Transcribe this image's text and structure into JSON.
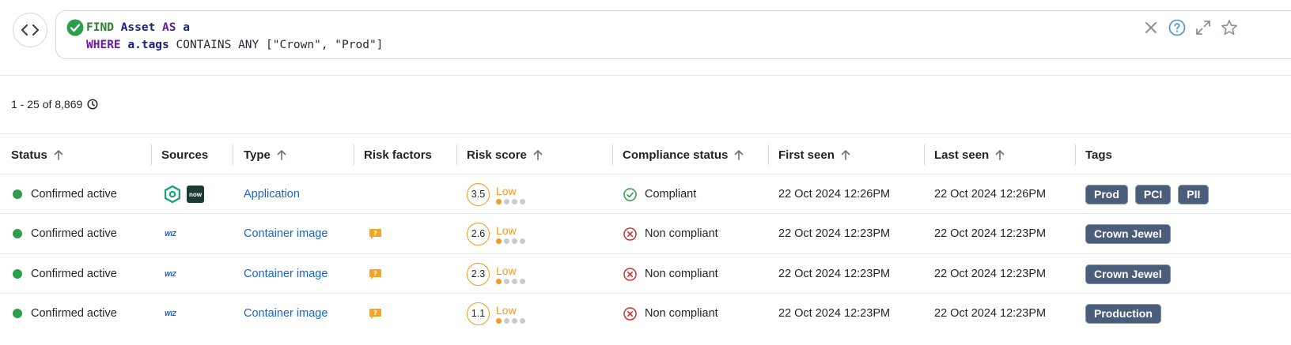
{
  "query": {
    "line1": [
      {
        "text": "FIND",
        "style": "kw-green"
      },
      {
        "text": " ",
        "style": "q-plain"
      },
      {
        "text": "Asset",
        "style": "kw-navy"
      },
      {
        "text": " ",
        "style": "q-plain"
      },
      {
        "text": "AS",
        "style": "kw-purple"
      },
      {
        "text": " ",
        "style": "q-plain"
      },
      {
        "text": "a",
        "style": "kw-navy"
      }
    ],
    "line2": [
      {
        "text": "WHERE",
        "style": "kw-purple"
      },
      {
        "text": " ",
        "style": "q-plain"
      },
      {
        "text": "a.tags",
        "style": "kw-navy"
      },
      {
        "text": " CONTAINS ANY [\"Crown\", \"Prod\"]",
        "style": "q-plain"
      }
    ],
    "icons": [
      "close-icon",
      "help-icon",
      "expand-icon",
      "star-icon"
    ]
  },
  "results": {
    "count_text": "1 - 25 of 8,869"
  },
  "table": {
    "columns": [
      {
        "label": "Status",
        "sortable": true
      },
      {
        "label": "Sources",
        "sortable": false
      },
      {
        "label": "Type",
        "sortable": true
      },
      {
        "label": "Risk factors",
        "sortable": false
      },
      {
        "label": "Risk score",
        "sortable": true
      },
      {
        "label": "Compliance status",
        "sortable": true
      },
      {
        "label": "First seen",
        "sortable": true
      },
      {
        "label": "Last seen",
        "sortable": true
      },
      {
        "label": "Tags",
        "sortable": false
      }
    ],
    "rows": [
      {
        "status": "Confirmed active",
        "sources": [
          "hexagon-source-icon",
          "now-source-icon"
        ],
        "now_label": "now",
        "type": "Application",
        "risk_factor": false,
        "score": "3.5",
        "score_label": "Low",
        "score_level": 1,
        "compliance": "Compliant",
        "compliant": true,
        "first_seen": "22 Oct 2024 12:26PM",
        "last_seen": "22 Oct 2024 12:26PM",
        "tags": [
          "Prod",
          "PCI",
          "PII"
        ]
      },
      {
        "status": "Confirmed active",
        "sources": [
          "wiz-source-icon"
        ],
        "wiz_label": "WIZ",
        "type": "Container image",
        "risk_factor": true,
        "score": "2.6",
        "score_label": "Low",
        "score_level": 1,
        "compliance": "Non compliant",
        "compliant": false,
        "first_seen": "22 Oct 2024 12:23PM",
        "last_seen": "22 Oct 2024 12:23PM",
        "tags": [
          "Crown Jewel"
        ]
      },
      {
        "status": "Confirmed active",
        "sources": [
          "wiz-source-icon"
        ],
        "wiz_label": "WIZ",
        "type": "Container image",
        "risk_factor": true,
        "score": "2.3",
        "score_label": "Low",
        "score_level": 1,
        "compliance": "Non compliant",
        "compliant": false,
        "first_seen": "22 Oct 2024 12:23PM",
        "last_seen": "22 Oct 2024 12:23PM",
        "tags": [
          "Crown Jewel"
        ]
      },
      {
        "status": "Confirmed active",
        "sources": [
          "wiz-source-icon"
        ],
        "wiz_label": "WIZ",
        "type": "Container image",
        "risk_factor": true,
        "score": "1.1",
        "score_label": "Low",
        "score_level": 1,
        "compliance": "Non compliant",
        "compliant": false,
        "first_seen": "22 Oct 2024 12:23PM",
        "last_seen": "22 Oct 2024 12:23PM",
        "tags": [
          "Production"
        ]
      }
    ]
  },
  "colors": {
    "status_active": "#2e9e4c",
    "risk_low": "#f29c1f",
    "compliant": "#2e9e4c",
    "non_compliant": "#d32f2f",
    "tag_bg": "#4a5d7a",
    "link": "#1b64c4"
  }
}
